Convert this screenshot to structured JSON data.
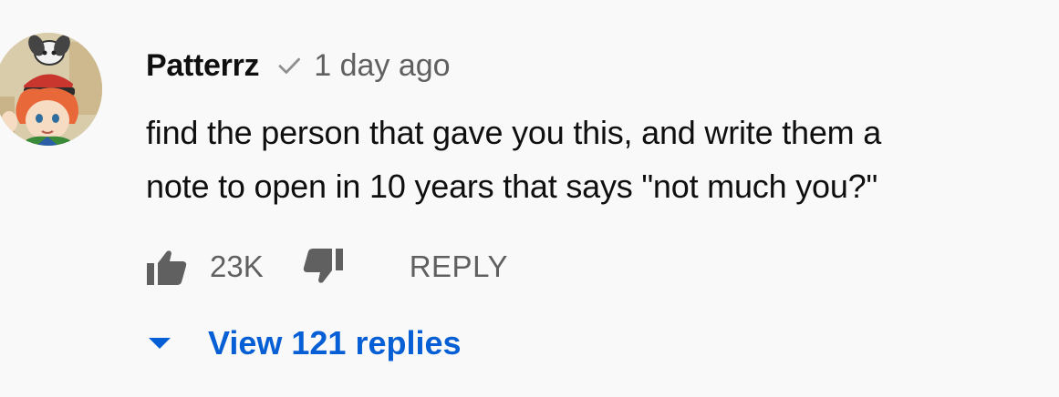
{
  "comment": {
    "author": "Patterrz",
    "verified_icon": "checkmark-icon",
    "timestamp": "1 day ago",
    "text_lines": [
      "find the person that gave you this, and write them a",
      "note to open in 10 years that says \"not much you?\""
    ],
    "like_count": "23K",
    "like_icon": "thumbs-up-icon",
    "dislike_icon": "thumbs-down-icon",
    "reply_label": "REPLY",
    "view_replies_label": "View 121 replies",
    "view_replies_icon": "caret-down-icon"
  },
  "colors": {
    "background": "#f9f9f9",
    "text_primary": "#0f0f0f",
    "text_secondary": "#606060",
    "link_blue": "#065fd4"
  }
}
